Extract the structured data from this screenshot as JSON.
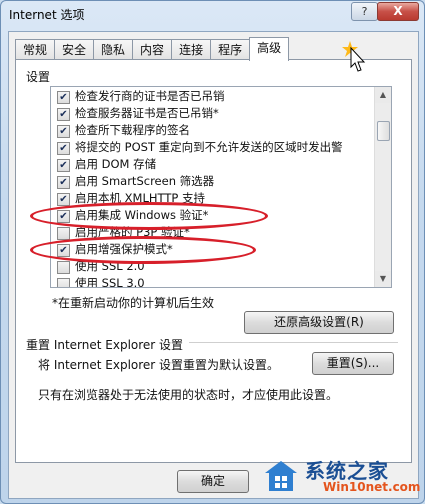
{
  "window": {
    "title": "Internet 选项",
    "help_glyph": "?",
    "close_glyph": "X"
  },
  "tabs": [
    {
      "label": "常规"
    },
    {
      "label": "安全"
    },
    {
      "label": "隐私"
    },
    {
      "label": "内容"
    },
    {
      "label": "连接"
    },
    {
      "label": "程序"
    },
    {
      "label": "高级",
      "active": true
    }
  ],
  "settings_label": "设置",
  "settings_list": [
    {
      "label": "检查发行商的证书是否已吊销",
      "checked": true
    },
    {
      "label": "检查服务器证书是否已吊销*",
      "checked": true
    },
    {
      "label": "检查所下载程序的签名",
      "checked": true
    },
    {
      "label": "将提交的 POST 重定向到不允许发送的区域时发出警",
      "checked": true
    },
    {
      "label": "启用 DOM 存储",
      "checked": true
    },
    {
      "label": "启用 SmartScreen 筛选器",
      "checked": true
    },
    {
      "label": "启用本机 XMLHTTP 支持",
      "checked": true
    },
    {
      "label": "启用集成 Windows 验证*",
      "checked": true
    },
    {
      "label": "启用严格的 P3P 验证*",
      "checked": false
    },
    {
      "label": "启用增强保护模式*",
      "checked": true
    },
    {
      "label": "使用 SSL 2.0",
      "checked": false
    },
    {
      "label": "使用 SSL 3.0",
      "checked": false
    }
  ],
  "restart_note": "*在重新启动你的计算机后生效",
  "restore_advanced_button": "还原高级设置(R)",
  "reset_section": {
    "title": "重置 Internet Explorer 设置",
    "description": "将 Internet Explorer 设置重置为默认设置。",
    "reset_button": "重置(S)...",
    "note": "只有在浏览器处于无法使用的状态时，才应使用此设置。"
  },
  "ok_button": "确定",
  "highlight_color": "#d71f2a",
  "watermark": {
    "line1": "系统之家",
    "line2": "Win10net.com"
  }
}
